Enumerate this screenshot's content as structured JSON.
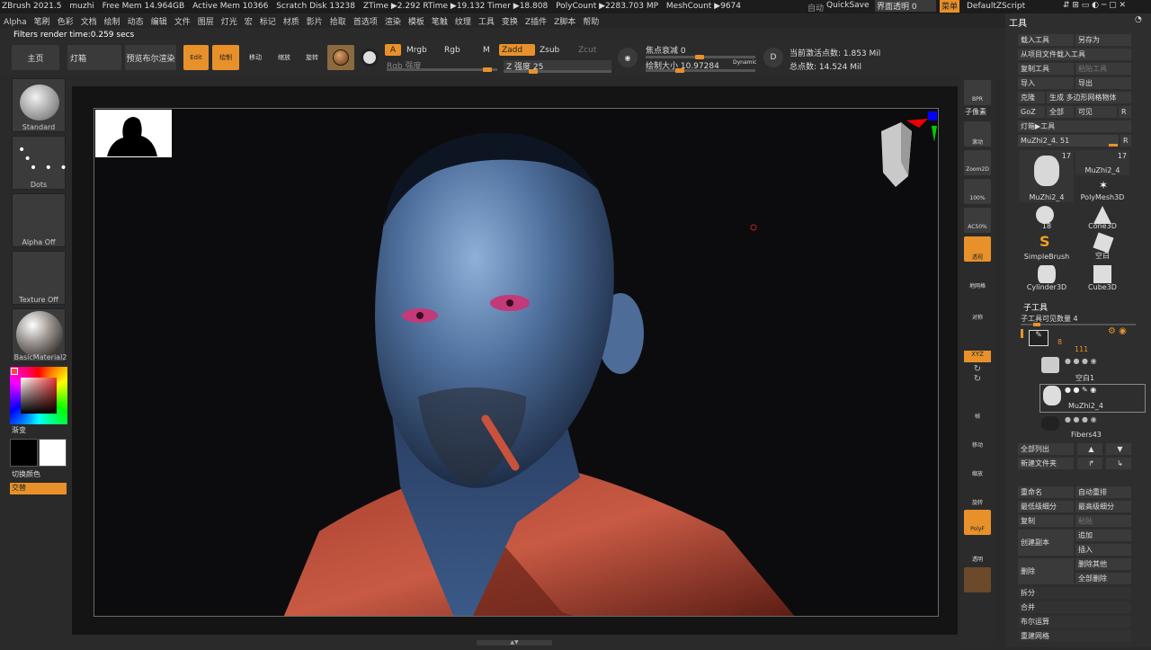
{
  "status": {
    "app": "ZBrush 2021.5",
    "doc": "muzhi",
    "free_mem": "Free Mem 14.964GB",
    "active_mem": "Active Mem 10366",
    "scratch": "Scratch Disk 13238",
    "ztime": "ZTime ▶2.292 RTime ▶19.132 Timer ▶18.808",
    "polycount": "PolyCount ▶2283.703 MP",
    "meshcount": "MeshCount ▶9674",
    "auto": "自动",
    "quicksave": "QuickSave",
    "transparency": "界面透明 0",
    "menu_btn": "菜单",
    "script": "DefaultZScript"
  },
  "menus": [
    "Alpha",
    "笔刷",
    "色彩",
    "文档",
    "绘制",
    "动态",
    "编辑",
    "文件",
    "图层",
    "灯光",
    "宏",
    "标记",
    "材质",
    "影片",
    "拾取",
    "首选项",
    "渲染",
    "模板",
    "笔触",
    "纹理",
    "工具",
    "变换",
    "Z插件",
    "Z脚本",
    "帮助"
  ],
  "render_time": "Filters render time:0.259 secs",
  "toolbar": {
    "home": "主页",
    "lightbox": "灯箱",
    "bpr": "预览布尔渲染",
    "edit": "Edit",
    "draw": "绘制",
    "move": "移动",
    "scale": "缩放",
    "rotate": "旋转",
    "a": "A",
    "mrgb": "Mrgb",
    "rgb": "Rgb",
    "m": "M",
    "rgb_intensity": "Rgb 强度",
    "zadd": "Zadd",
    "zsub": "Zsub",
    "zcut": "Zcut",
    "z_intensity": "Z 强度 25",
    "focal": "焦点衰减 0",
    "draw_size": "绘制大小 10.97284",
    "dynamic": "Dynamic",
    "active_points": "当前激活点数: 1.853 Mil",
    "total_points": "总点数: 14.524 Mil",
    "z_intensity_level": 0.25,
    "rgb_intensity_level": 0.95
  },
  "left": {
    "brush": "Standard",
    "stroke": "Dots",
    "alpha": "Alpha Off",
    "texture": "Texture Off",
    "material": "BasicMaterial2",
    "gradient": "渐变",
    "swap": "切换颜色",
    "alternate": "交替"
  },
  "shelf": [
    "BPR",
    "子像素",
    "滚动",
    "Zoom2D",
    "100%",
    "AC50%",
    "透视",
    "地网格",
    "对称",
    "",
    "XYZ",
    "",
    "帧",
    "移动",
    "缩放",
    "旋转",
    "PolyF",
    "透明",
    "",
    ""
  ],
  "panel": {
    "title": "工具",
    "load": "载入工具",
    "save_as": "另存为",
    "load_project": "从项目文件载入工具",
    "copy_tool": "复制工具",
    "paste_tool": "粘贴工具",
    "import": "导入",
    "export": "导出",
    "clone": "克隆",
    "make_polymesh": "生成 多边形网格物体",
    "goz": "GoZ",
    "all": "全部",
    "visible": "可见",
    "r": "R",
    "lightbox_tool": "灯箱▶工具",
    "current": "MuZhi2_4. 51",
    "tiles": [
      {
        "name": "MuZhi2_4",
        "count": "17"
      },
      {
        "name": "MuZhi2_4",
        "count": "17"
      },
      {
        "name": "PolyMesh3D",
        "count": ""
      },
      {
        "name": "18",
        "count": ""
      },
      {
        "name": "Cone3D",
        "count": ""
      },
      {
        "name": "SimpleBrush",
        "count": ""
      },
      {
        "name": "空白",
        "count": ""
      },
      {
        "name": "Cylinder3D",
        "count": ""
      },
      {
        "name": "Cube3D",
        "count": ""
      }
    ],
    "subtool": "子工具",
    "subtool_visible": "子工具可见数量 4",
    "folder_count": "8",
    "sub_count": "111",
    "sub_items": [
      "空白1",
      "MuZhi2_4",
      "Fibers43"
    ],
    "list_all": "全部列出",
    "new_folder": "新建文件夹",
    "rename": "重命名",
    "auto_reorder": "自动重排",
    "lowest": "最低级细分",
    "highest": "最高级细分",
    "copy": "复制",
    "paste": "粘贴",
    "append": "追加",
    "create_copy": "创建副本",
    "insert": "插入",
    "delete": "删除",
    "delete_other": "删除其他",
    "delete_all": "全部删除",
    "split": "拆分",
    "merge": "合并",
    "boolean": "布尔运算",
    "remesh": "重建网格"
  }
}
